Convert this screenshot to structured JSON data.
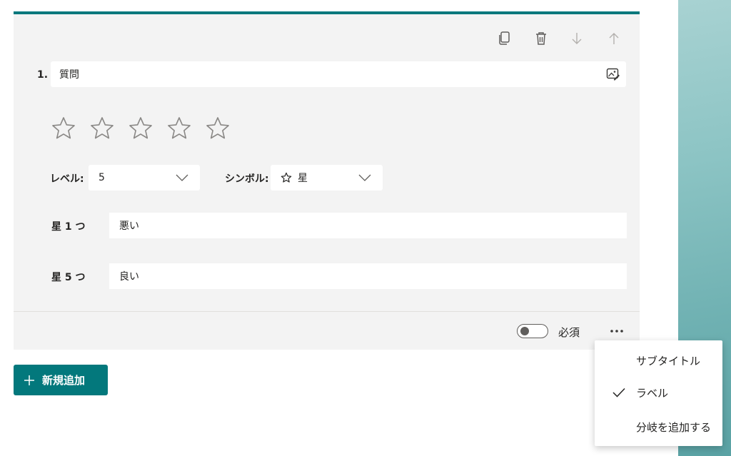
{
  "question": {
    "number": "1.",
    "placeholder": "質問"
  },
  "rating": {
    "star_count": 5,
    "level_label": "レベル:",
    "level_value": "5",
    "symbol_label": "シンボル:",
    "symbol_value": "星"
  },
  "labels": [
    {
      "label": "星 1 つ",
      "value": "悪い"
    },
    {
      "label": "星 5 つ",
      "value": "良い"
    }
  ],
  "footer": {
    "required_label": "必須",
    "required_on": false
  },
  "add_button": {
    "label": "新規追加"
  },
  "context_menu": {
    "items": [
      {
        "label": "サブタイトル",
        "checked": false
      },
      {
        "label": "ラベル",
        "checked": true
      },
      {
        "label": "分岐を追加する",
        "checked": false
      }
    ]
  },
  "colors": {
    "accent": "#03787c",
    "card_bg": "#f3f3f3"
  },
  "icons": {
    "toolbar": [
      "copy-icon",
      "delete-icon",
      "move-down-icon",
      "move-up-icon"
    ],
    "question_media": "insert-image-icon"
  }
}
